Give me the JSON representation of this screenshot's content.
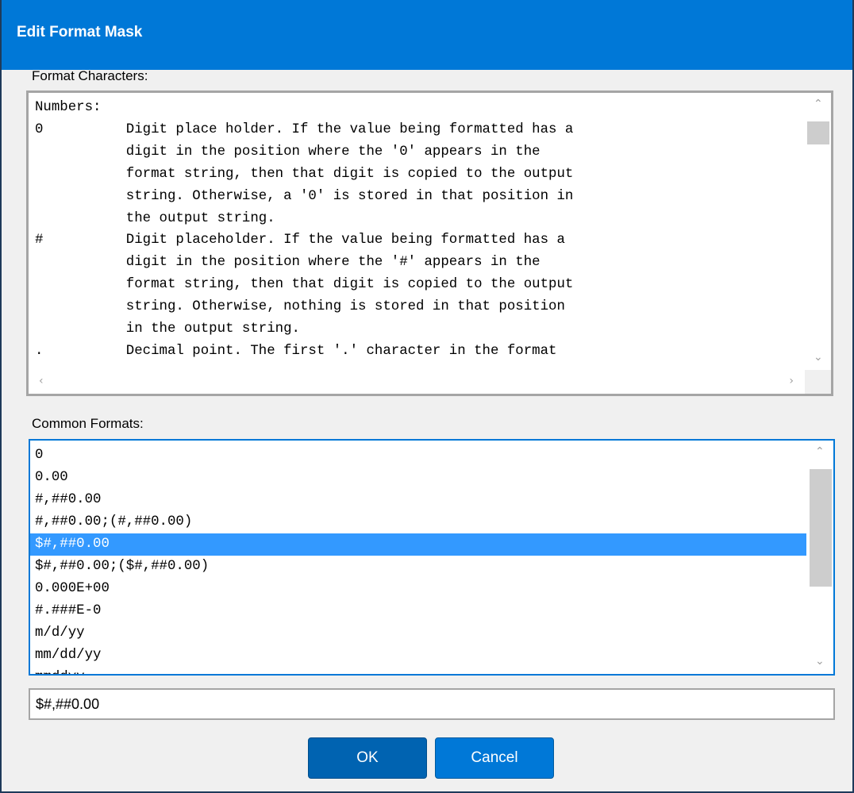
{
  "dialog": {
    "title": "Edit Format Mask",
    "format_characters_label": "Format Characters:",
    "format_characters_text": "Numbers:\n0          Digit place holder. If the value being formatted has a\n           digit in the position where the '0' appears in the\n           format string, then that digit is copied to the output\n           string. Otherwise, a '0' is stored in that position in\n           the output string.\n#          Digit placeholder. If the value being formatted has a\n           digit in the position where the '#' appears in the\n           format string, then that digit is copied to the output\n           string. Otherwise, nothing is stored in that position\n           in the output string.\n.          Decimal point. The first '.' character in the format",
    "common_formats_label": "Common Formats:",
    "common_formats": [
      "0",
      "0.00",
      "#,##0.00",
      "#,##0.00;(#,##0.00)",
      "$#,##0.00",
      "$#,##0.00;($#,##0.00)",
      "0.000E+00",
      "#.###E-0",
      "m/d/yy",
      "mm/dd/yy",
      "mmddyy"
    ],
    "selected_format": "$#,##0.00",
    "mask_value": "$#,##0.00",
    "ok_label": "OK",
    "cancel_label": "Cancel"
  },
  "colors": {
    "titlebar": "#0078d7",
    "selection": "#3399ff",
    "button": "#0078d7"
  }
}
